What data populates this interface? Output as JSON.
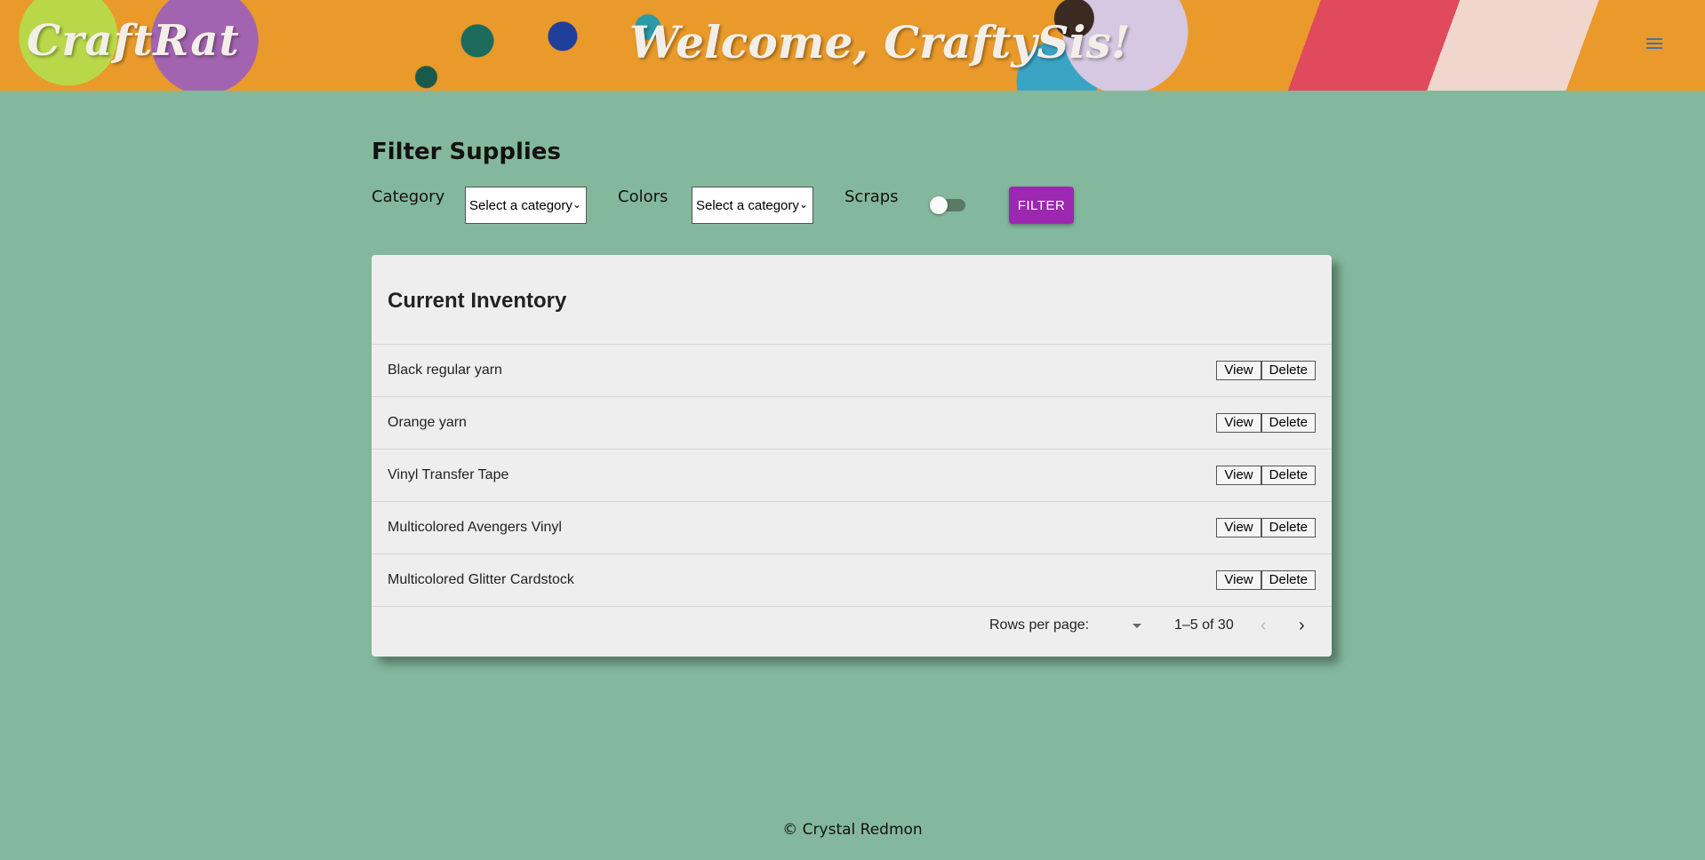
{
  "header": {
    "brand": "CraftRat",
    "welcome": "Welcome, CraftySis!"
  },
  "filter": {
    "title": "Filter Supplies",
    "category_label": "Category",
    "category_select": "Select a category",
    "colors_label": "Colors",
    "colors_select": "Select a category",
    "scraps_label": "Scraps",
    "scraps_on": false,
    "button": "FILTER"
  },
  "inventory": {
    "title": "Current Inventory",
    "view_label": "View",
    "delete_label": "Delete",
    "items": [
      "Black regular yarn",
      "Orange yarn",
      "Vinyl Transfer Tape",
      "Multicolored Avengers Vinyl",
      "Multicolored Glitter Cardstock"
    ],
    "pagination": {
      "rows_per_page_label": "Rows per page:",
      "range": "1–5 of 30"
    }
  },
  "footer": "© Crystal Redmon",
  "colors": {
    "background": "#84b89c",
    "accent": "#9c27b0"
  }
}
